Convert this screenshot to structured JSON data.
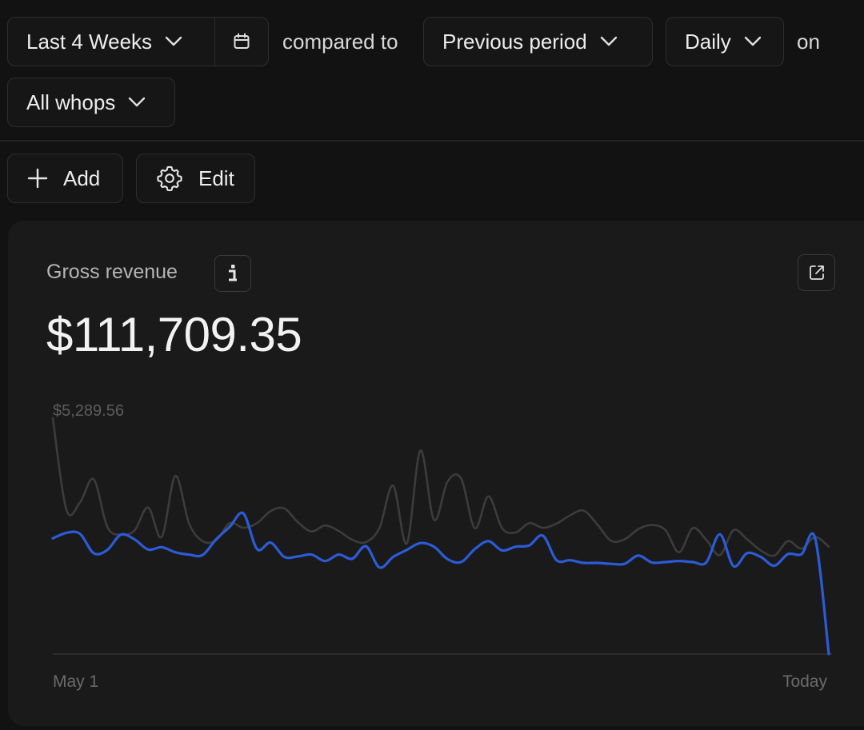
{
  "filters": {
    "range_label": "Last 4 Weeks",
    "compared_to_text": "compared to",
    "comparison_label": "Previous period",
    "interval_label": "Daily",
    "on_text": "on",
    "scope_label": "All whops"
  },
  "toolbar": {
    "add_label": "Add",
    "edit_label": "Edit"
  },
  "card": {
    "title": "Gross revenue",
    "value": "$111,709.35"
  },
  "colors": {
    "current_series": "#2b5bd7",
    "previous_series": "#3c3c3c",
    "background": "#121212",
    "card": "#1a1a1a"
  },
  "chart_data": {
    "type": "line",
    "x_start_label": "May 1",
    "x_end_label": "Today",
    "y_max_label": "$5,289.56",
    "ylim": [
      0,
      5289.56
    ],
    "grid": false,
    "legend": "none",
    "series": [
      {
        "values": [
          2500,
          2620,
          2600,
          2180,
          2250,
          2580,
          2480,
          2260,
          2310,
          2200,
          2150,
          2140,
          2480,
          2750,
          3040,
          2270,
          2410,
          2100,
          2110,
          2150,
          2010,
          2150,
          2060,
          2330,
          1870,
          2100,
          2250,
          2400,
          2320,
          2050,
          1990,
          2270,
          2440,
          2240,
          2320,
          2350,
          2560,
          2030,
          2030,
          1970,
          1970,
          1950,
          1950,
          2130,
          1980,
          1990,
          2010,
          1990,
          1980,
          2590,
          1900,
          2180,
          2100,
          1910,
          2160,
          2160,
          2500,
          0
        ]
      },
      {
        "values": [
          5100,
          3120,
          3280,
          3780,
          2750,
          2580,
          2670,
          3170,
          2530,
          3850,
          2830,
          2440,
          2460,
          2830,
          2730,
          2830,
          3090,
          3150,
          2850,
          2650,
          2780,
          2660,
          2470,
          2420,
          2730,
          3640,
          2390,
          4400,
          2900,
          3730,
          3790,
          2720,
          3410,
          2720,
          2630,
          2830,
          2730,
          2820,
          3000,
          3100,
          2800,
          2450,
          2480,
          2700,
          2790,
          2680,
          2200,
          2720,
          2470,
          2140,
          2680,
          2480,
          2240,
          2130,
          2440,
          2280,
          2530,
          2320
        ]
      }
    ]
  }
}
